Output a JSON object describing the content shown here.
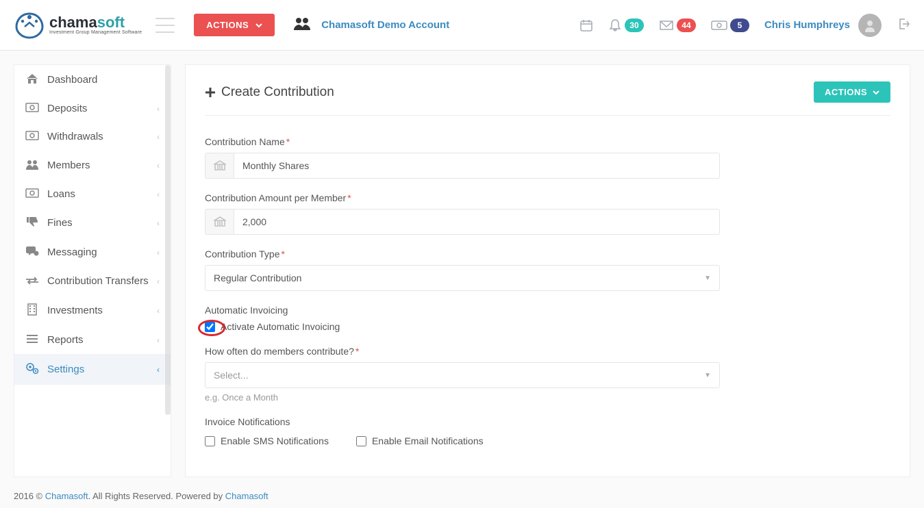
{
  "brand": {
    "part1": "chama",
    "part2": "soft",
    "tagline": "Investment Group Management Software"
  },
  "top": {
    "actions_label": "ACTIONS",
    "account_name": "Chamasoft Demo Account",
    "badge_notifs": "30",
    "badge_msgs": "44",
    "badge_funds": "5",
    "user_name": "Chris Humphreys"
  },
  "sidebar": {
    "items": [
      {
        "label": "Dashboard",
        "has_children": false
      },
      {
        "label": "Deposits",
        "has_children": true
      },
      {
        "label": "Withdrawals",
        "has_children": true
      },
      {
        "label": "Members",
        "has_children": true
      },
      {
        "label": "Loans",
        "has_children": true
      },
      {
        "label": "Fines",
        "has_children": true
      },
      {
        "label": "Messaging",
        "has_children": true
      },
      {
        "label": "Contribution Transfers",
        "has_children": true
      },
      {
        "label": "Investments",
        "has_children": true
      },
      {
        "label": "Reports",
        "has_children": true
      },
      {
        "label": "Settings",
        "has_children": true,
        "active": true
      }
    ]
  },
  "page": {
    "title": "Create Contribution",
    "actions_label": "ACTIONS"
  },
  "form": {
    "name_label": "Contribution Name",
    "name_value": "Monthly Shares",
    "amount_label": "Contribution Amount per Member",
    "amount_value": "2,000",
    "type_label": "Contribution Type",
    "type_value": "Regular Contribution",
    "auto_invoice_heading": "Automatic Invoicing",
    "auto_invoice_check_label": "Activate Automatic Invoicing",
    "auto_invoice_checked": true,
    "frequency_label": "How often do members contribute?",
    "frequency_placeholder": "Select...",
    "frequency_hint": "e.g. Once a Month",
    "notif_heading": "Invoice Notifications",
    "sms_label": "Enable SMS Notifications",
    "email_label": "Enable Email Notifications"
  },
  "footer": {
    "text1": "2016 © ",
    "link1": "Chamasoft",
    "text2": ". All Rights Reserved. Powered by ",
    "link2": "Chamasoft"
  }
}
